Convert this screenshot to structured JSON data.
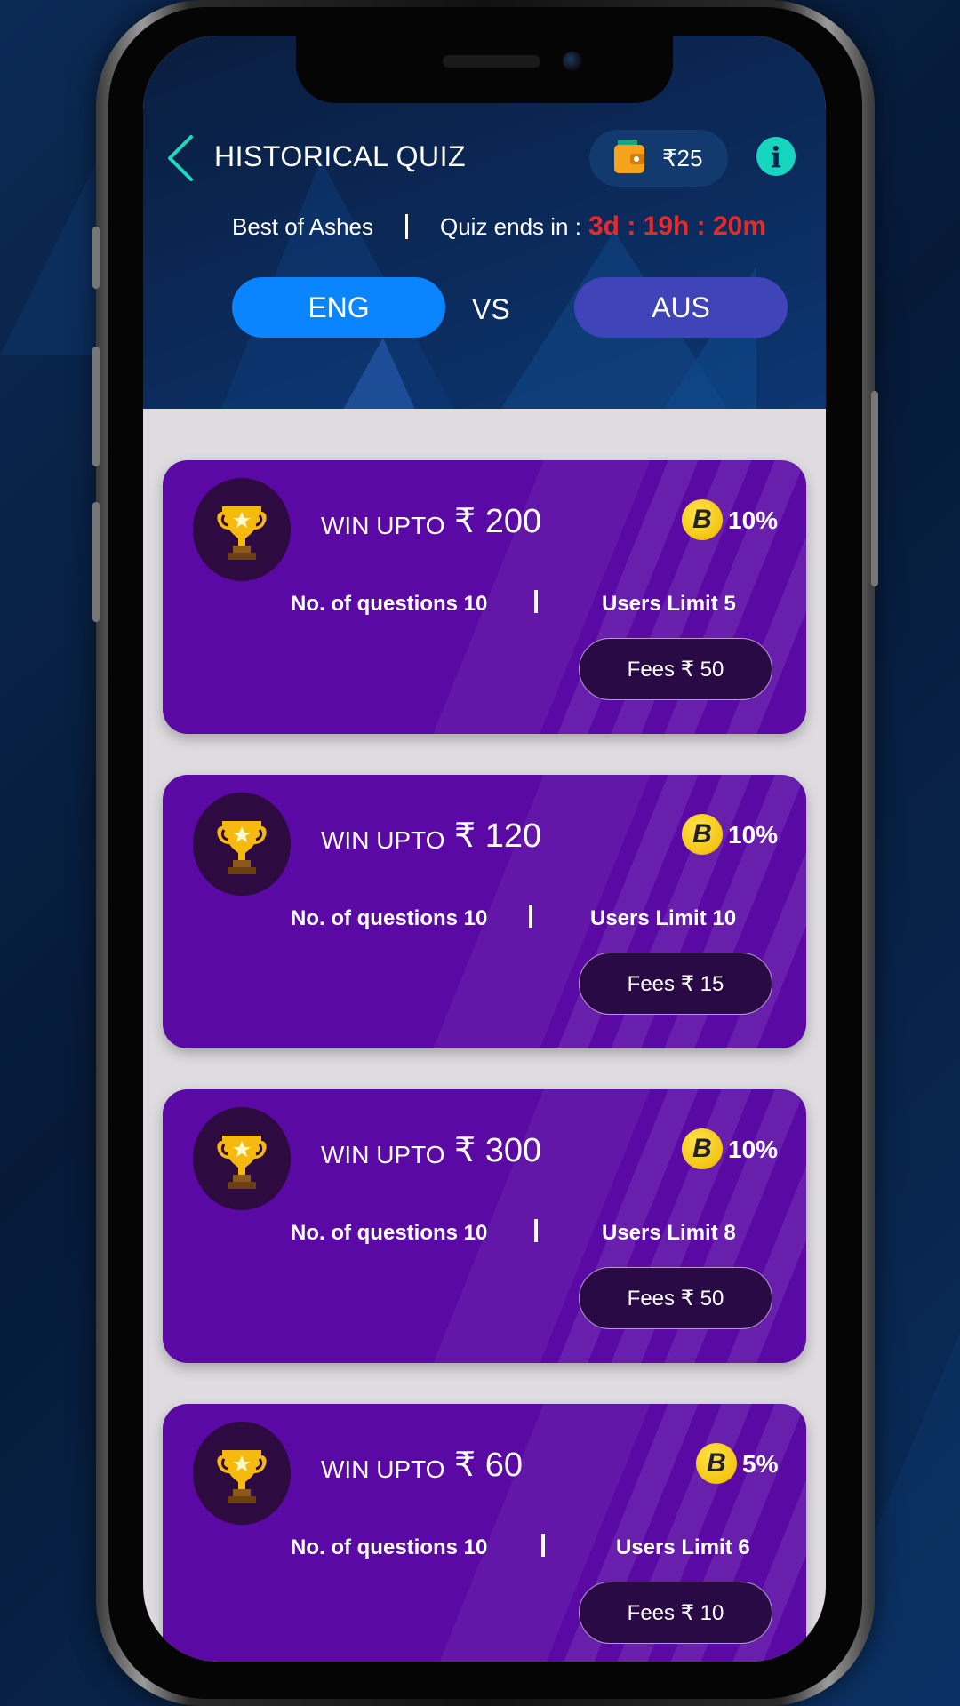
{
  "header": {
    "title": "HISTORICAL QUIZ",
    "wallet_amount": "₹25",
    "info_label": "i"
  },
  "quiz": {
    "name": "Best of Ashes",
    "ends_label": "Quiz ends in :",
    "countdown": "3d : 19h : 20m"
  },
  "match": {
    "team_a": "ENG",
    "vs": "VS",
    "team_b": "AUS"
  },
  "cards": [
    {
      "win_label": "WIN UPTO",
      "amount": "₹ 200",
      "bonus": "10%",
      "questions": "No. of questions 10",
      "users": "Users Limit 5",
      "fees": "Fees ₹ 50"
    },
    {
      "win_label": "WIN UPTO",
      "amount": "₹ 120",
      "bonus": "10%",
      "questions": "No. of questions 10",
      "users": "Users Limit 10",
      "fees": "Fees ₹ 15"
    },
    {
      "win_label": "WIN UPTO",
      "amount": "₹ 300",
      "bonus": "10%",
      "questions": "No. of questions 10",
      "users": "Users Limit 8",
      "fees": "Fees ₹ 50"
    },
    {
      "win_label": "WIN UPTO",
      "amount": "₹ 60",
      "bonus": "5%",
      "questions": "No. of questions 10",
      "users": "Users Limit 6",
      "fees": "Fees ₹ 10"
    }
  ],
  "coin_letter": "B",
  "colors": {
    "card": "#5a09a4",
    "team_a": "#0a84ff",
    "team_b": "#3f44b8",
    "countdown": "#e62a2a",
    "info": "#17d6c0"
  }
}
